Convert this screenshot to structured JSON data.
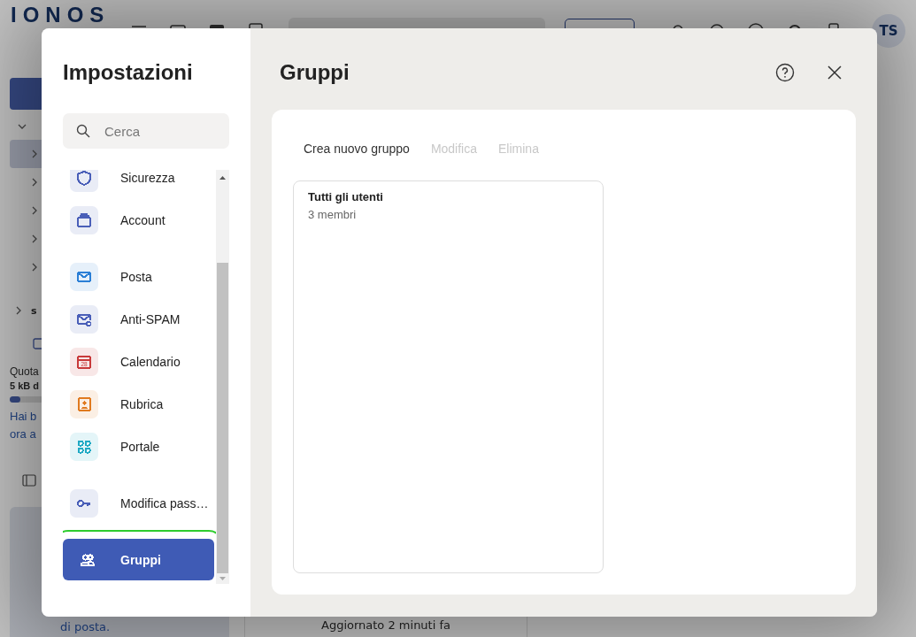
{
  "background": {
    "logo": "IONOS",
    "avatar": "TS",
    "tree_rows": [
      {
        "selected": true
      },
      {
        "selected": false
      },
      {
        "selected": false
      },
      {
        "selected": false
      },
      {
        "selected": false
      }
    ],
    "folder_label": "s",
    "quota": {
      "label": "Quota",
      "value": "5 kB d",
      "level": 0.05
    },
    "upsell_lines": [
      "Hai b",
      "ora a"
    ],
    "promo_text": "di posta.",
    "status": "Aggiornato 2 minuti fa"
  },
  "settings": {
    "title": "Impostazioni",
    "search": {
      "placeholder": "Cerca"
    },
    "sections": [
      [
        {
          "label": "Sicurezza",
          "kind": "shield",
          "color": "#4a5fb8",
          "selected": false
        },
        {
          "label": "Account",
          "kind": "wallet",
          "color": "#4a5fb8",
          "selected": false
        }
      ],
      [
        {
          "label": "Posta",
          "kind": "mail",
          "color": "#2b7fd6",
          "selected": false
        },
        {
          "label": "Anti-SPAM",
          "kind": "mail-minus",
          "color": "#4a5fb8",
          "selected": false
        },
        {
          "label": "Calendario",
          "kind": "calendar",
          "color": "#c8393a",
          "badge": "28",
          "selected": false
        },
        {
          "label": "Rubrica",
          "kind": "contact",
          "color": "#e07a1f",
          "selected": false
        },
        {
          "label": "Portale",
          "kind": "grid",
          "color": "#1fa9c4",
          "selected": false
        }
      ],
      [
        {
          "label": "Modifica pass…",
          "kind": "key",
          "color": "#4a5fb8",
          "selected": false
        }
      ],
      [
        {
          "label": "Gruppi",
          "kind": "people",
          "color": "#ffffff",
          "selected": true
        }
      ]
    ]
  },
  "panel": {
    "title": "Gruppi",
    "toolbar": [
      {
        "label": "Crea nuovo gruppo",
        "disabled": false
      },
      {
        "label": "Modifica",
        "disabled": true
      },
      {
        "label": "Elimina",
        "disabled": true
      }
    ],
    "groups": [
      {
        "name": "Tutti gli utenti",
        "members": "3 membri"
      }
    ]
  }
}
